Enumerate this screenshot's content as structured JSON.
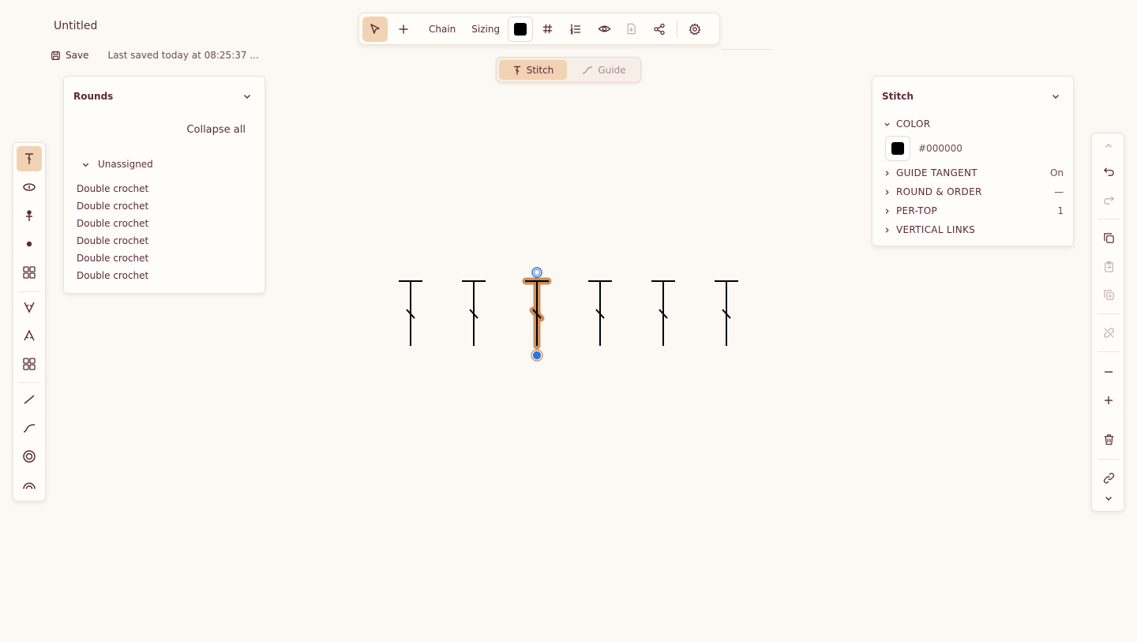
{
  "document": {
    "title": "Untitled",
    "save_label": "Save",
    "last_saved": "Last saved today at 08:25:37 ..."
  },
  "toolbar": {
    "select_icon": "cursor-arrow-icon",
    "add_icon": "plus-icon",
    "chain_label": "Chain",
    "sizing_label": "Sizing",
    "color": "#000000",
    "grid_icon": "hash-icon",
    "numbered_list_icon": "numbered-list-icon",
    "visibility_icon": "eye-icon",
    "export_icon": "file-export-icon",
    "share_icon": "share-icon",
    "settings_icon": "gear-icon"
  },
  "mode_toggle": {
    "stitch_label": "Stitch",
    "guide_label": "Guide",
    "active": "Stitch"
  },
  "rounds_panel": {
    "title": "Rounds",
    "collapse_all": "Collapse all",
    "group_label": "Unassigned",
    "items": [
      "Double crochet",
      "Double crochet",
      "Double crochet",
      "Double crochet",
      "Double crochet",
      "Double crochet"
    ]
  },
  "stitch_panel": {
    "title": "Stitch",
    "color_section": "COLOR",
    "color_value": "#000000",
    "sections": [
      {
        "label": "GUIDE TANGENT",
        "value": "On"
      },
      {
        "label": "ROUND & ORDER",
        "value": "—"
      },
      {
        "label": "PER-TOP",
        "value": "1"
      },
      {
        "label": "VERTICAL LINKS",
        "value": ""
      }
    ]
  },
  "colors": {
    "accent": "#f1d2b3",
    "text": "#5b2a36",
    "background": "#fcf9f4",
    "selection": "#c8844a",
    "handle": "#2f73e8"
  },
  "canvas": {
    "stitch_count": 6,
    "selected_index": 2,
    "stitch_type": "Double crochet"
  }
}
